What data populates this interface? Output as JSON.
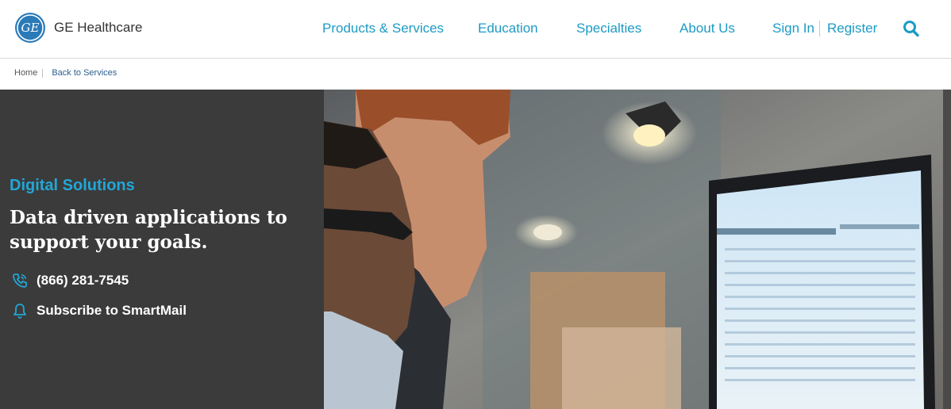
{
  "brand": {
    "name": "GE Healthcare",
    "logo_text": "GE"
  },
  "nav": {
    "items": [
      {
        "label": "Products & Services"
      },
      {
        "label": "Education"
      },
      {
        "label": "Specialties"
      },
      {
        "label": "About Us"
      }
    ],
    "sign_in": "Sign In",
    "register": "Register",
    "search_icon": "search-icon"
  },
  "breadcrumb": {
    "home": "Home",
    "back": "Back to Services"
  },
  "hero": {
    "eyebrow": "Digital Solutions",
    "headline": "Data driven applications to support your goals.",
    "phone": "(866) 281-7545",
    "subscribe": "Subscribe to SmartMail",
    "icons": {
      "phone": "phone-icon",
      "subscribe": "bell-icon"
    }
  },
  "colors": {
    "accent": "#1d9bc4",
    "eyebrow": "#22a7d6",
    "hero_bg": "#3b3b3b"
  }
}
